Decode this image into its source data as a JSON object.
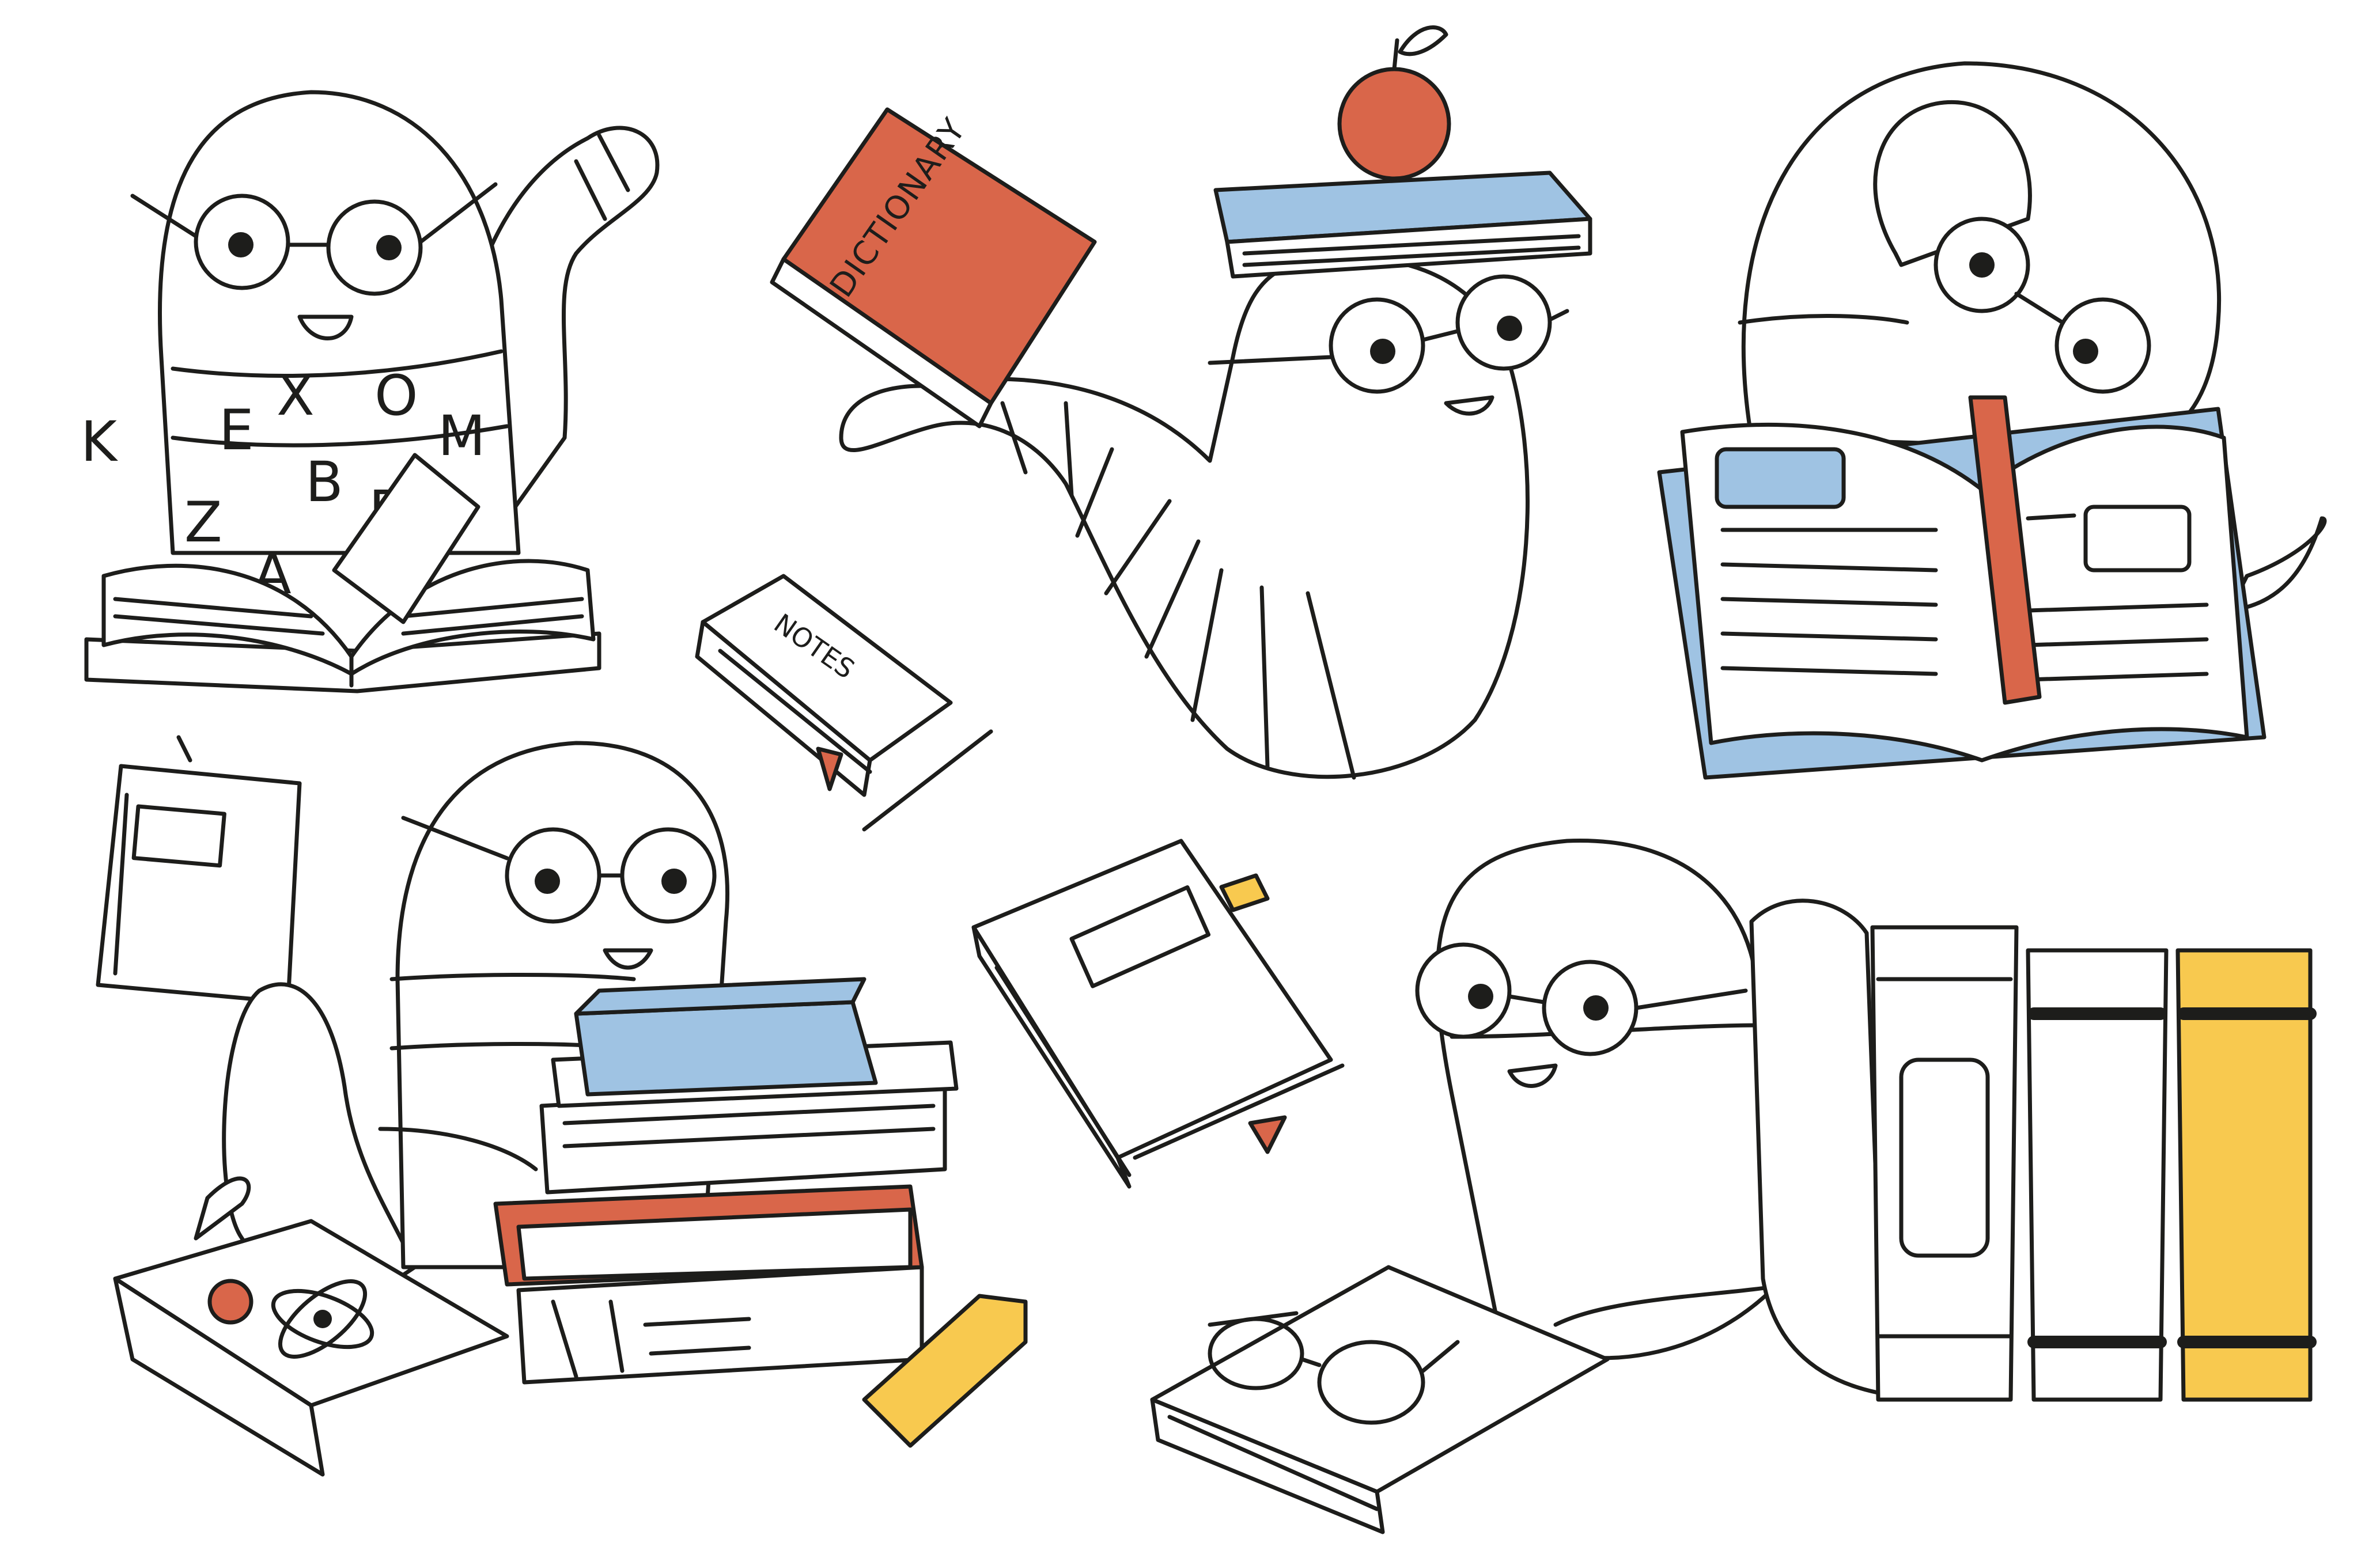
{
  "palette": {
    "ink": "#1d1d1b",
    "orange": "#d9664a",
    "blue": "#9fc3e3",
    "yellow": "#f8c94f",
    "paper": "#ffffff"
  },
  "alphabet_letters": [
    "K",
    "E",
    "X",
    "O",
    "M",
    "B",
    "Z",
    "A",
    "R"
  ],
  "dictionary_label": "DICTIONARY",
  "notes_label": "NOTES"
}
